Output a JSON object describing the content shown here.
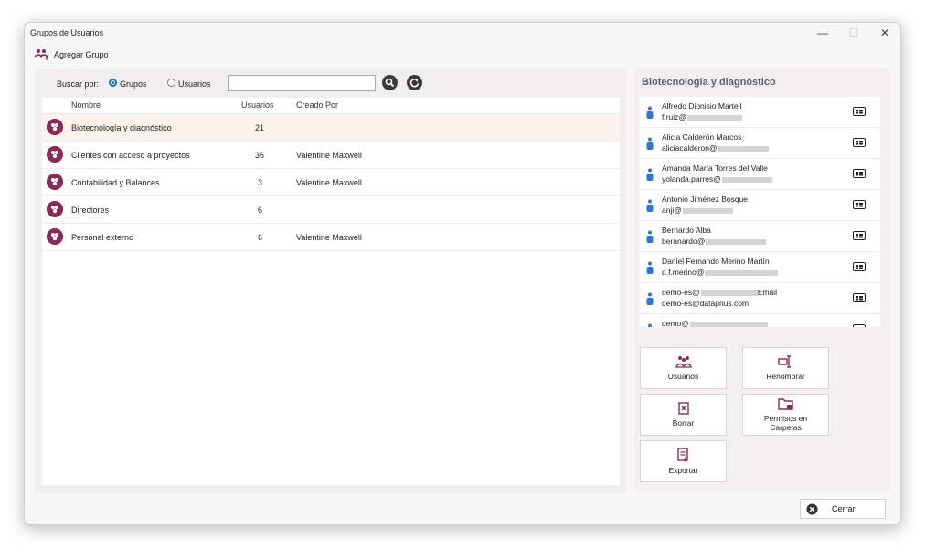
{
  "window": {
    "title": "Grupos de Usuarios",
    "minimize": "—",
    "maximize": "☐",
    "close": "✕"
  },
  "toolbar": {
    "add_group_label": "Agregar Grupo"
  },
  "search": {
    "label": "Buscar por:",
    "option_groups": "Grupos",
    "option_users": "Usuarios",
    "selected": "Grupos",
    "value": ""
  },
  "table": {
    "headers": {
      "name": "Nombre",
      "users": "Usuarios",
      "created_by": "Creado Por"
    },
    "rows": [
      {
        "name": "Biotecnología y diagnóstico",
        "users": "21",
        "created_by": ""
      },
      {
        "name": "Clientes con acceso a proyectos",
        "users": "36",
        "created_by": "Valentine Maxwell"
      },
      {
        "name": "Contabilidad y Balances",
        "users": "3",
        "created_by": "Valentine Maxwell"
      },
      {
        "name": "Directores",
        "users": "6",
        "created_by": ""
      },
      {
        "name": "Personal externo",
        "users": "6",
        "created_by": "Valentine Maxwell"
      }
    ]
  },
  "details": {
    "title": "Biotecnología y diagnóstico",
    "users": [
      {
        "name": "Alfredo Dionisio Martell",
        "email": "f.ruiz@"
      },
      {
        "name": "Alicia Calderón Marcos",
        "email": "aliciacalderon@"
      },
      {
        "name": "Amanda María Torres del Valle",
        "email": "yolanda.parres@"
      },
      {
        "name": "Antonio Jiménez Bosque",
        "email": "anji@"
      },
      {
        "name": "Bernardo Alba",
        "email": "beranardo@"
      },
      {
        "name": "Daniel Fernando Merino Martín",
        "email": "d.f.merino@"
      },
      {
        "name": "demo-es@",
        "name_suffix": "Email",
        "email": "demo-es@dataprius.com"
      },
      {
        "name": "demo@",
        "email": ""
      }
    ],
    "actions": {
      "users": "Usuarios",
      "rename": "Renombrar",
      "delete": "Borrar",
      "permissions": "Permisos en Carpetas",
      "export": "Exportar"
    }
  },
  "footer": {
    "close_label": "Cerrar"
  },
  "colors": {
    "accent": "#8c2957",
    "radio": "#1c6fd1",
    "selected_row": "#fcf4ec"
  }
}
